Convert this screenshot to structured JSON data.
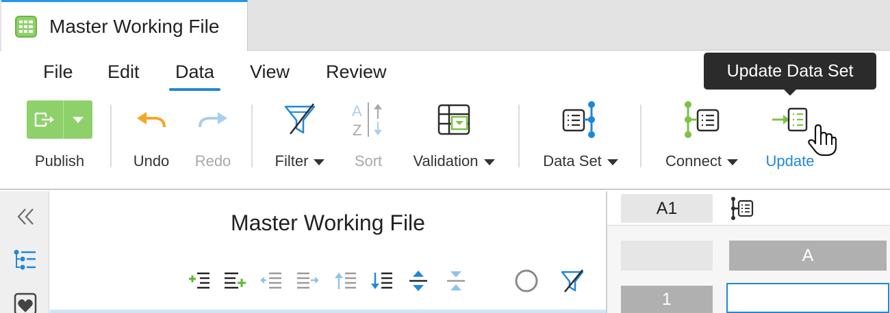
{
  "tab": {
    "title": "Master Working File",
    "icon": "spreadsheet-icon"
  },
  "menu": {
    "items": [
      {
        "label": "File"
      },
      {
        "label": "Edit"
      },
      {
        "label": "Data",
        "active": true
      },
      {
        "label": "View"
      },
      {
        "label": "Review"
      }
    ]
  },
  "toolbar": {
    "publish": "Publish",
    "undo": "Undo",
    "redo": "Redo",
    "filter": "Filter",
    "sort": "Sort",
    "validation": "Validation",
    "dataset": "Data Set",
    "connect": "Connect",
    "update": "Update"
  },
  "tooltip": {
    "text": "Update Data Set"
  },
  "panel": {
    "title": "Master Working File"
  },
  "sheet": {
    "cell_ref": "A1",
    "column_a": "A",
    "row_1": "1"
  },
  "colors": {
    "accent": "#1f87d8",
    "green": "#7dc243",
    "orange": "#f5a623",
    "tab_border": "#2196f3"
  }
}
